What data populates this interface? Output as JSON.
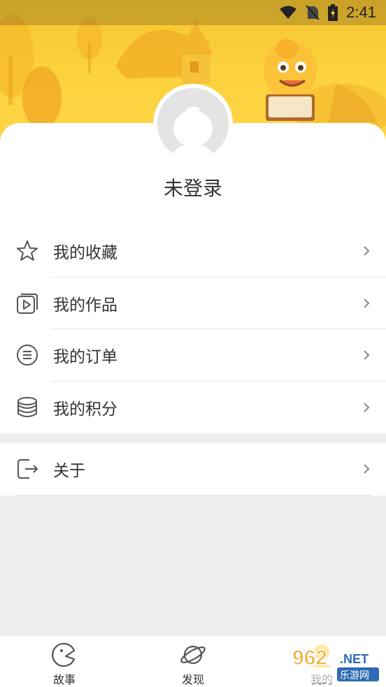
{
  "status_bar": {
    "time": "2:41",
    "icons": [
      "wifi-icon",
      "no-sim-icon",
      "battery-charging-icon"
    ]
  },
  "profile": {
    "username": "未登录"
  },
  "menu": {
    "items": [
      {
        "label": "我的收藏",
        "icon": "star-icon"
      },
      {
        "label": "我的作品",
        "icon": "video-stack-icon"
      },
      {
        "label": "我的订单",
        "icon": "list-circle-icon"
      },
      {
        "label": "我的积分",
        "icon": "coin-stack-icon"
      }
    ]
  },
  "about": {
    "label": "关于",
    "icon": "exit-icon"
  },
  "tabbar": {
    "tabs": [
      {
        "label": "故事",
        "icon": "story-icon"
      },
      {
        "label": "发现",
        "icon": "planet-icon"
      },
      {
        "label": "我的",
        "icon": "profile-icon",
        "active": true
      }
    ]
  },
  "watermark": {
    "number": "962",
    "suffix": ".NET",
    "text": "乐游网"
  },
  "colors": {
    "header_yellow": "#fcd23c",
    "text": "#333333",
    "divider": "#e6e6e6",
    "background": "#efefef"
  }
}
